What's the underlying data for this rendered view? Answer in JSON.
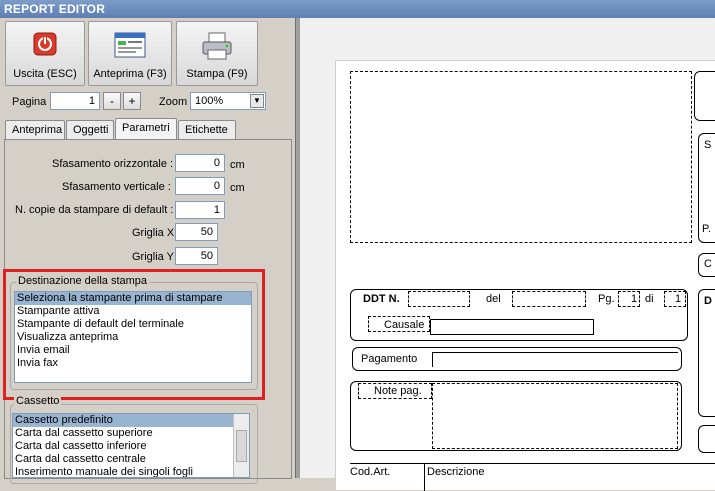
{
  "window": {
    "title": "REPORT EDITOR"
  },
  "toolbar": {
    "exit_label": "Uscita (ESC)",
    "preview_label": "Anteprima (F3)",
    "print_label": "Stampa (F9)"
  },
  "pager": {
    "page_label": "Pagina",
    "page_value": "1",
    "minus": "-",
    "plus": "+",
    "zoom_label": "Zoom",
    "zoom_value": "100%"
  },
  "tabs": [
    "Anteprima",
    "Oggetti",
    "Parametri",
    "Etichette"
  ],
  "params": {
    "offset_h_label": "Sfasamento orizzontale :",
    "offset_h_value": "0",
    "offset_h_unit": "cm",
    "offset_v_label": "Sfasamento verticale :",
    "offset_v_value": "0",
    "offset_v_unit": "cm",
    "copies_label": "N. copie da stampare di default :",
    "copies_value": "1",
    "grid_x_label": "Griglia X",
    "grid_x_value": "50",
    "grid_y_label": "Griglia Y",
    "grid_y_value": "50"
  },
  "destination": {
    "title": "Destinazione della stampa",
    "items": [
      "Seleziona la stampante prima di stampare",
      "Stampante attiva",
      "Stampante di default del terminale",
      "Visualizza anteprima",
      "Invia email",
      "Invia fax"
    ],
    "selected_index": 0
  },
  "tray": {
    "title": "Cassetto",
    "items": [
      "Cassetto predefinito",
      "Carta dal cassetto superiore",
      "Carta dal cassetto inferiore",
      "Carta dal cassetto centrale",
      "Inserimento manuale dei singoli fogli"
    ],
    "selected_index": 0
  },
  "report": {
    "ddt": "DDT N.",
    "del": "del",
    "pg": "Pg.",
    "pg_value": "1",
    "di": "di",
    "di_value": "1",
    "causale": "Causale",
    "pagamento": "Pagamento",
    "note": "Note pag.",
    "cod_art": "Cod.Art.",
    "descrizione": "Descrizione",
    "right_s": "S",
    "right_p": "P.",
    "right_c": "C",
    "right_d": "D"
  },
  "colors": {
    "highlight": "#e02020",
    "selection": "#99b4d1"
  }
}
